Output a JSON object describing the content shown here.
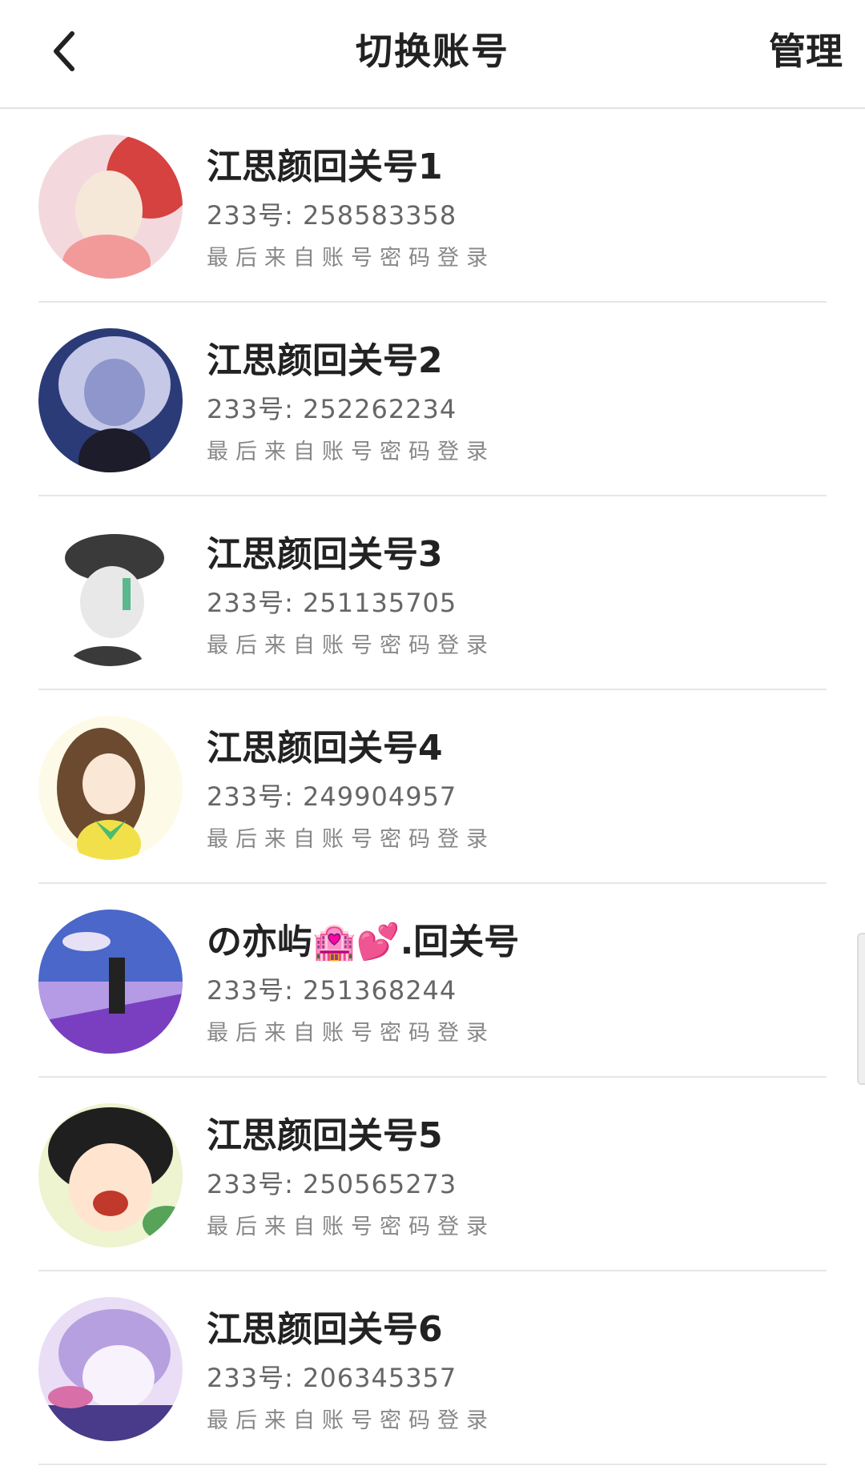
{
  "header": {
    "title": "切换账号",
    "manage_label": "管理",
    "back_icon": "chevron-left-icon"
  },
  "accounts": [
    {
      "name": "江思颜回关号1",
      "id_text": "233号: 258583358",
      "source": "最后来自账号密码登录",
      "avatar_colors": [
        "#f3d9de",
        "#d6423f",
        "#f6e8d8",
        "#f29a9a"
      ]
    },
    {
      "name": "江思颜回关号2",
      "id_text": "233号: 252262234",
      "source": "最后来自账号密码登录",
      "avatar_colors": [
        "#2b3b78",
        "#c5c8e6",
        "#1c1c2a",
        "#8f96cc"
      ]
    },
    {
      "name": "江思颜回关号3",
      "id_text": "233号: 251135705",
      "source": "最后来自账号密码登录",
      "avatar_colors": [
        "#ffffff",
        "#3a3a3a",
        "#e8e8e8",
        "#5bb88c"
      ]
    },
    {
      "name": "江思颜回关号4",
      "id_text": "233号: 249904957",
      "source": "最后来自账号密码登录",
      "avatar_colors": [
        "#fdfbe8",
        "#6b4a2f",
        "#f2e04a",
        "#4cbb6b"
      ]
    },
    {
      "name": "の亦屿🏩💕.回关号",
      "id_text": "233号: 251368244",
      "source": "最后来自账号密码登录",
      "avatar_colors": [
        "#4a67c9",
        "#b59ae6",
        "#7a3fc0",
        "#e6e1f5"
      ]
    },
    {
      "name": "江思颜回关号5",
      "id_text": "233号: 250565273",
      "source": "最后来自账号密码登录",
      "avatar_colors": [
        "#eef3d0",
        "#1f1f1f",
        "#ffe5d0",
        "#57a35a"
      ]
    },
    {
      "name": "江思颜回关号6",
      "id_text": "233号: 206345357",
      "source": "最后来自账号密码登录",
      "avatar_colors": [
        "#e9def5",
        "#b7a0e0",
        "#f7f2fb",
        "#4a3a8a"
      ]
    }
  ]
}
